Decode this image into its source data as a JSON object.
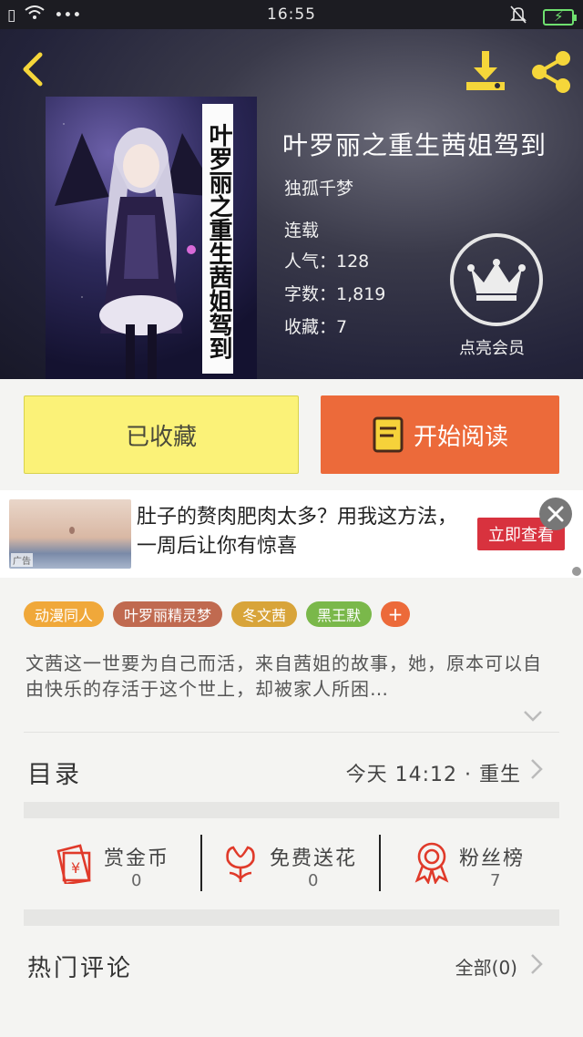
{
  "status_bar": {
    "time": "16:55"
  },
  "book": {
    "cover_title": "叶罗丽之重生茜姐驾到",
    "title": "叶罗丽之重生茜姐驾到",
    "author": "独孤千梦",
    "status": "连载",
    "popularity": "人气：128",
    "word_count": "字数：1,819",
    "favorites": "收藏：7"
  },
  "vip": {
    "label": "点亮会员"
  },
  "actions": {
    "collected_label": "已收藏",
    "read_label": "开始阅读"
  },
  "ad": {
    "text": "肚子的赘肉肥肉太多？用我这方法，一周后让你有惊喜",
    "button_label": "立即查看",
    "tag": "广告"
  },
  "tags": [
    {
      "label": "动漫同人",
      "color": "#f0a83a"
    },
    {
      "label": "叶罗丽精灵梦",
      "color": "#c06a50"
    },
    {
      "label": "冬文茜",
      "color": "#d8a43a"
    },
    {
      "label": "黑王默",
      "color": "#7ab84a"
    }
  ],
  "tag_add": "+",
  "synopsis": "文茜这一世要为自己而活，来自茜姐的故事，她，原本可以自由快乐的存活于这个世上，却被家人所困…",
  "toc": {
    "label": "目录",
    "latest": "今天 14:12 · 重生"
  },
  "rewards": [
    {
      "label": "赏金币",
      "count": "0",
      "icon": "red-envelope-icon"
    },
    {
      "label": "免费送花",
      "count": "0",
      "icon": "flower-icon"
    },
    {
      "label": "粉丝榜",
      "count": "7",
      "icon": "award-ribbon-icon"
    }
  ],
  "hot_comments": {
    "label": "热门评论",
    "all_label": "全部(0)"
  },
  "colors": {
    "accent": "#ec6a3a",
    "collected_bg": "#fbf278",
    "ad_button": "#d8323e",
    "icon_red": "#e03a2a"
  }
}
